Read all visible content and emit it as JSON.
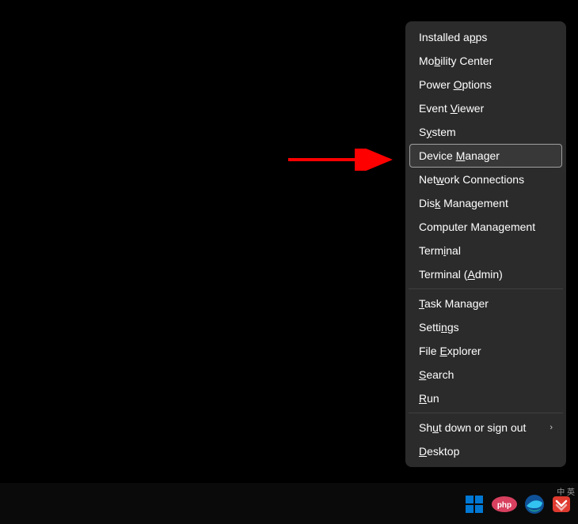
{
  "menu": {
    "group1": [
      {
        "pre": "Installed a",
        "accel": "p",
        "post": "ps"
      },
      {
        "pre": "Mo",
        "accel": "b",
        "post": "ility Center"
      },
      {
        "pre": "Power ",
        "accel": "O",
        "post": "ptions"
      },
      {
        "pre": "Event ",
        "accel": "V",
        "post": "iewer"
      },
      {
        "pre": "S",
        "accel": "y",
        "post": "stem"
      },
      {
        "pre": "Device ",
        "accel": "M",
        "post": "anager",
        "highlighted": true
      },
      {
        "pre": "Net",
        "accel": "w",
        "post": "ork Connections"
      },
      {
        "pre": "Dis",
        "accel": "k",
        "post": " Management"
      },
      {
        "pre": "Computer Mana",
        "accel": "g",
        "post": "ement"
      },
      {
        "pre": "Term",
        "accel": "i",
        "post": "nal"
      },
      {
        "pre": "Terminal (",
        "accel": "A",
        "post": "dmin)"
      }
    ],
    "group2": [
      {
        "pre": "",
        "accel": "T",
        "post": "ask Manager"
      },
      {
        "pre": "Setti",
        "accel": "n",
        "post": "gs"
      },
      {
        "pre": "File ",
        "accel": "E",
        "post": "xplorer"
      },
      {
        "pre": "",
        "accel": "S",
        "post": "earch"
      },
      {
        "pre": "",
        "accel": "R",
        "post": "un"
      }
    ],
    "group3": [
      {
        "pre": "Sh",
        "accel": "u",
        "post": "t down or sign out",
        "submenu": true
      },
      {
        "pre": "",
        "accel": "D",
        "post": "esktop"
      }
    ]
  },
  "tray": {
    "lang": "中 英"
  }
}
